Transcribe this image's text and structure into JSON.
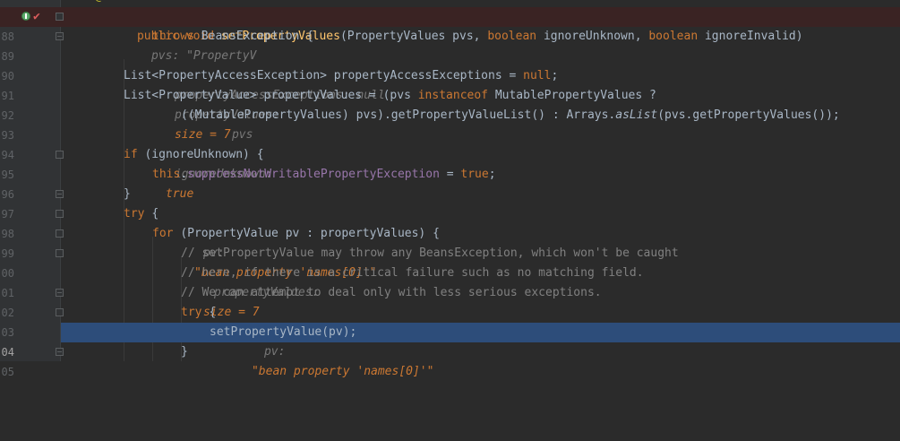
{
  "editor": {
    "annotation_fragment": "@Override",
    "lines": [
      {
        "num": "88"
      },
      {
        "num": "89"
      },
      {
        "num": "90"
      },
      {
        "num": "91"
      },
      {
        "num": "92"
      },
      {
        "num": "93"
      },
      {
        "num": "94"
      },
      {
        "num": "95"
      },
      {
        "num": "96"
      },
      {
        "num": "97"
      },
      {
        "num": "98"
      },
      {
        "num": "99"
      },
      {
        "num": "00"
      },
      {
        "num": "01"
      },
      {
        "num": "02"
      },
      {
        "num": "03"
      },
      {
        "num": "04"
      },
      {
        "num": "05"
      }
    ],
    "code": {
      "l88": {
        "mods": "public void ",
        "fn": "setPropertyValues",
        "p1": "(PropertyValues pvs, ",
        "kw1": "boolean ",
        "p2": "ignoreUnknown, ",
        "kw2": "boolean ",
        "p3": "ignoreInvalid)",
        "hint": "pvs: \"PropertyV"
      },
      "l89": {
        "kw": "throws ",
        "rest": "BeansException {"
      },
      "l91": {
        "a": "List<PropertyAccessException> propertyAccessExceptions = ",
        "kw": "null",
        "b": ";",
        "hint": "propertyAccessExceptions: null"
      },
      "l92": {
        "a": "List<PropertyValue> propertyValues = (pvs ",
        "kw": "instanceof ",
        "b": "MutablePropertyValues ?",
        "hint": "propertyValues:",
        "hintv": "size = 7"
      },
      "l93": {
        "a": "((MutablePropertyValues) pvs).getPropertyValueList() : Arrays.",
        "it": "asList",
        "b": "(pvs.getPropertyValues());",
        "hint": "pvs"
      },
      "l95": {
        "kw": "if ",
        "a": "(ignoreUnknown) {",
        "hint": "ignoreUnknown:",
        "hintv": "true"
      },
      "l96": {
        "kw": "this",
        "a": ".",
        "field": "suppressNotWritablePropertyException",
        "b": " = ",
        "kw2": "true",
        "c": ";"
      },
      "l97": {
        "a": "}"
      },
      "l98": {
        "kw": "try ",
        "a": "{"
      },
      "l99": {
        "kw": "for ",
        "a": "(PropertyValue pv : propertyValues) {",
        "hint": "pv:",
        "hintv": "\"bean property 'names[0]'\"",
        "hint2": "propertyValues:",
        "hintv2": "size = 7"
      },
      "l00": {
        "cmt": "// setPropertyValue may throw any BeansException, which won't be caught"
      },
      "l01": {
        "cmt": "// here, if there is a critical failure such as no matching field."
      },
      "l02": {
        "cmt": "// We can attempt to deal only with less serious exceptions."
      },
      "l03": {
        "kw": "try ",
        "a": "{"
      },
      "l04": {
        "a": "setPropertyValue(pv);",
        "hint": "pv:",
        "hintv": "\"bean property 'names[0]'\""
      },
      "l05": {
        "a": "}"
      }
    },
    "colors": {
      "background": "#2b2b2b",
      "gutter": "#313335",
      "keyword": "#cc7832",
      "method": "#ffc66d",
      "field": "#9876aa",
      "comment": "#808080",
      "execution_line": "#2d4d7a",
      "breakpoint_line": "#3a2323"
    }
  }
}
